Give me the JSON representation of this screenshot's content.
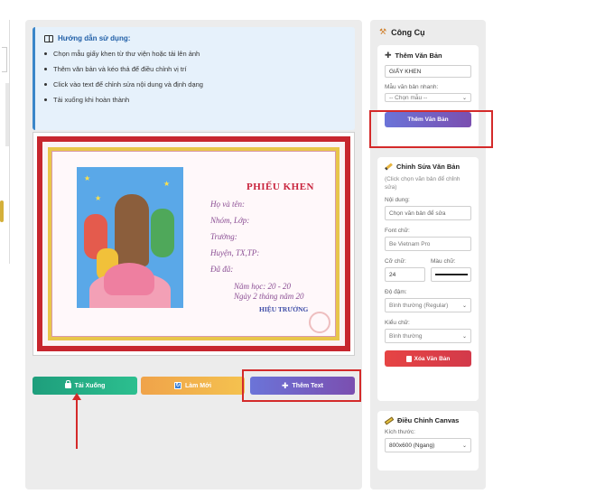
{
  "guide": {
    "title": "Hướng dẫn sử dụng:",
    "items": [
      "Chọn mẫu giấy khen từ thư viện hoặc tải lên ảnh",
      "Thêm văn bản và kéo thả để điều chỉnh vị trí",
      "Click vào text để chỉnh sửa nội dung và định dạng",
      "Tải xuống khi hoàn thành"
    ]
  },
  "certificate": {
    "title": "PHIẾU KHEN",
    "lines": [
      "Họ và tên:",
      "Nhóm, Lớp:",
      "Trường:",
      "Huyện, TX,TP:",
      "Đã đã:"
    ],
    "year": "Năm học: 20   - 20",
    "date": "Ngày 2  tháng    năm 20",
    "signer": "HIỆU TRƯỞNG"
  },
  "actions": {
    "download": "Tải Xuống",
    "reset": "Làm Mới",
    "add_text": "Thêm Text"
  },
  "sidebar": {
    "title": "Công Cụ",
    "add_text_card": {
      "title": "Thêm Văn Bản",
      "input_value": "GIẤY KHEN",
      "quick_label": "Mẫu văn bản nhanh:",
      "quick_selected": "-- Chọn mẫu --",
      "button": "Thêm Văn Bản"
    },
    "edit_card": {
      "title": "Chỉnh Sửa Văn Bản",
      "hint": "(Click chọn văn bản để chỉnh sửa)",
      "content_label": "Nội dung:",
      "content_value": "Chọn văn bản để sửa",
      "font_label": "Font chữ:",
      "font_value": "Be Vietnam Pro",
      "size_label": "Cỡ chữ:",
      "size_value": "24",
      "color_label": "Màu chữ:",
      "weight_label": "Độ đậm:",
      "weight_value": "Bình thường (Regular)",
      "style_label": "Kiểu chữ:",
      "style_value": "Bình thường",
      "delete_button": "Xóa Văn Bản"
    },
    "canvas_card": {
      "title": "Điều Chỉnh Canvas",
      "size_label": "Kích thước:",
      "size_value": "800x600 (Ngang)"
    }
  },
  "colors": {
    "accent_red": "#d42a2a",
    "primary_purple": "#6b74d8",
    "download_green": "#1e9e7c",
    "reset_orange": "#f0a34a"
  }
}
